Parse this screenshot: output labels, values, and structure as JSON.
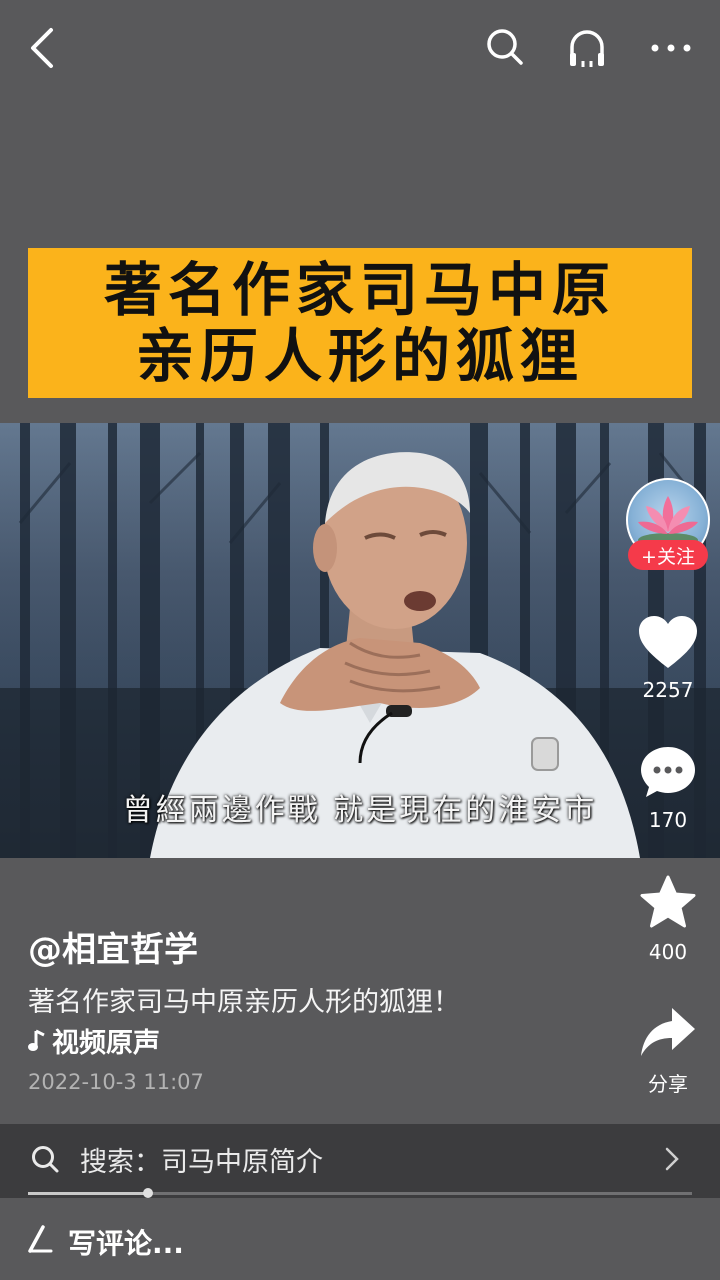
{
  "header": {
    "back_icon": "chevron-left-icon",
    "search_icon": "search-icon",
    "listen_icon": "headphones-icon",
    "more_icon": "more-dots-icon"
  },
  "video": {
    "title_line1": "著名作家司马中原",
    "title_line2": "亲历人形的狐狸",
    "subtitle": "曾經兩邊作戰 就是現在的淮安市",
    "title_bg": "#fbb31b"
  },
  "creator": {
    "follow_label": "+关注",
    "follow_color": "#f53a4a"
  },
  "actions": {
    "likes": "2257",
    "comments": "170",
    "favorites": "400",
    "share_label": "分享"
  },
  "post": {
    "author": "@相宜哲学",
    "description": "著名作家司马中原亲历人形的狐狸！",
    "music": "视频原声",
    "date": "2022-10-3 11:07"
  },
  "search": {
    "text": "搜索：司马中原简介",
    "progress": 0.18
  },
  "comment": {
    "placeholder": "写评论..."
  }
}
